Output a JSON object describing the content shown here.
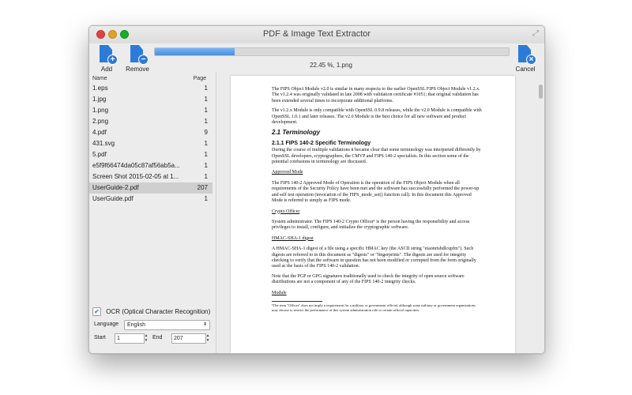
{
  "window": {
    "title": "PDF & Image Text Extractor"
  },
  "toolbar": {
    "add_label": "Add",
    "remove_label": "Remove",
    "cancel_label": "Cancel"
  },
  "progress": {
    "text": "22.45 %, 1.png",
    "fraction": 0.2245
  },
  "file_list": {
    "col_name": "Name",
    "col_page": "Page",
    "rows": [
      {
        "name": "1.eps",
        "page": "1"
      },
      {
        "name": "1.jpg",
        "page": "1"
      },
      {
        "name": "1.png",
        "page": "1"
      },
      {
        "name": "2.png",
        "page": "1"
      },
      {
        "name": "4.pdf",
        "page": "9"
      },
      {
        "name": "431.svg",
        "page": "1"
      },
      {
        "name": "5.pdf",
        "page": "1"
      },
      {
        "name": "e5f9f66474da05c87af56ab5a...",
        "page": "1"
      },
      {
        "name": "Screen Shot 2015-02-05 at 1...",
        "page": "1"
      },
      {
        "name": "UserGuide-2.pdf",
        "page": "207"
      },
      {
        "name": "UserGuide.pdf",
        "page": "1"
      }
    ],
    "selected_index": 9
  },
  "options": {
    "ocr_label": "OCR (Optical Character Recognition)",
    "ocr_checked": true,
    "language_label": "Language",
    "language_value": "English",
    "start_label": "Start",
    "start_value": "1",
    "end_label": "End",
    "end_value": "207"
  },
  "document": {
    "p1": "The FIPS Object Module v2.0 is similar in many respects to the earlier OpenSSL FIPS Object Module v1.2.x. The v1.2.4 was originally validated in late 2008 with validation certificate #1051; that original validation has been extended several times to incorporate additional platforms.",
    "p2": "The v1.2.x Module is only compatible with OpenSSL 0.9.8 releases, while the v2.0 Module is compatible with OpenSSL 1.0.1 and later releases. The v2.0 Module is the best choice for all new software and product development.",
    "h_section": "2.1    Terminology",
    "h_sub": "2.1.1  FIPS 140-2 Specific Terminology",
    "p3": "During the course of multiple validations it became clear that some terminology was interpreted differently by OpenSSL developers, cryptographers, the CMVP and FIPS 140-2 specialists. In this section some of the potential confusions in terminology are discussed.",
    "term1": "Approved Mode",
    "p4": "The FIPS 140-2 Approved Mode of Operation is the operation of the FIPS Object Module when all requirements of the Security Policy have been met and the software has successfully performed the power-up and self test operation (invocation of the FIPS_mode_set() function call). In this document this Approved Mode is referred to simply as FIPS mode.",
    "term2": "Crypto Officer",
    "p5": "System administrator. The FIPS 140-2 Crypto Officer¹ is the person having the responsibility and access privileges to install, configure, and initialize the cryptographic software.",
    "term3": "HMAC-SHA-1 digest",
    "p6": "A HMAC-SHA-1 digest of a file using a specific HMAC key (the ASCII string \"etaonrishdlcupfm\"). Such digests are referred to in this document as \"digests\" or \"fingerprints\". The digests are used for integrity checking to verify that the software in question has not been modified or corrupted from the form originally used as the basis of the FIPS 140-2 validation.",
    "p7": "Note that the PGP or GPG signatures traditionally used to check the integrity of open source software distributions are not a component of any of the FIPS 140-2 integrity checks.",
    "term4": "Module",
    "footnote": "¹The term \"Officer\" does not imply a requirement for a military or government official, although some military or government organizations may choose to restrict the performance of this system administration role to certain official capacities."
  }
}
